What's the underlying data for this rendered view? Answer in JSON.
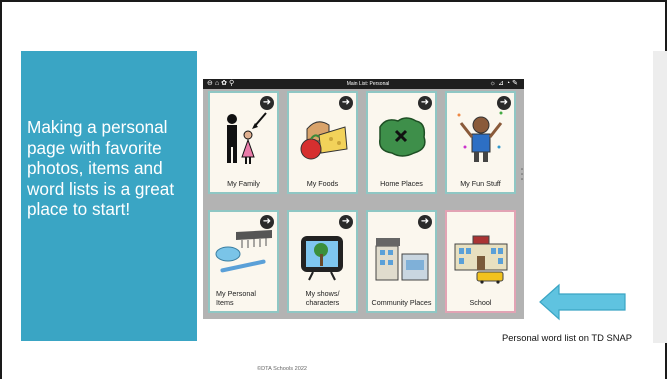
{
  "slide": {
    "body_text": "Making a personal page with favorite photos, items and word lists is a great place to start!",
    "caption": "Personal word list on TD SNAP",
    "footer": "©DTA Schools 2022"
  },
  "app": {
    "title": "Main List: Personal",
    "left_toolbar_icons": [
      "back-icon",
      "home-icon",
      "settings-icon",
      "search-icon"
    ],
    "right_toolbar_icons": [
      "light-icon",
      "chart-icon",
      "quick-icon",
      "edit-icon"
    ],
    "tiles": [
      {
        "label": "My Family",
        "icon": "family-icon"
      },
      {
        "label": "My Foods",
        "icon": "foods-icon"
      },
      {
        "label": "Home Places",
        "icon": "map-icon"
      },
      {
        "label": "My Fun Stuff",
        "icon": "fun-icon"
      },
      {
        "label": "My Personal Items",
        "icon": "personal-items-icon"
      },
      {
        "label": "My shows/ characters",
        "icon": "tv-icon"
      },
      {
        "label": "Community Places",
        "icon": "buildings-icon"
      },
      {
        "label": "School",
        "icon": "school-icon"
      }
    ]
  },
  "colors": {
    "teal_box": "#3aa5c4",
    "callout_arrow": "#5fc3e0",
    "tile_border": "#8fc7c4",
    "school_border": "#e2a3b4"
  }
}
